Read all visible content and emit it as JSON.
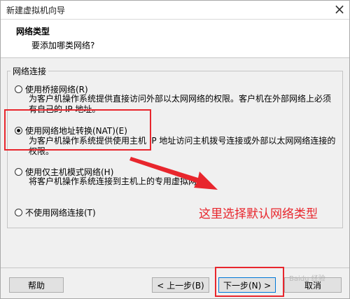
{
  "window": {
    "title": "新建虚拟机向导",
    "close_symbol": "×"
  },
  "header": {
    "title": "网络类型",
    "subtitle": "要添加哪类网络?"
  },
  "group": {
    "label": "网络连接"
  },
  "options": [
    {
      "label": "使用桥接网络(R)",
      "checked": false,
      "desc_line1": "为客户机操作系统提供直接访问外部以太网网络的权限。客户机在外部网络上必须",
      "desc_line2": "有自己的 IP 地址。"
    },
    {
      "label": "使用网络地址转换(NAT)(E)",
      "checked": true,
      "desc_line1": "为客户机操作系统提供使用主机 IP 地址访问主机拨号连接或外部以太网网络连接的",
      "desc_line2": "权限。"
    },
    {
      "label": "使用仅主机模式网络(H)",
      "checked": false,
      "desc_line1": "将客户机操作系统连接到主机上的专用虚拟网络。"
    },
    {
      "label": "不使用网络连接(T)",
      "checked": false
    }
  ],
  "annotation": {
    "text": "这里选择默认网络类型",
    "color": "#e8262d"
  },
  "buttons": {
    "help": "帮助",
    "back": "< 上一步(B)",
    "next": "下一步(N) >",
    "cancel": "取消"
  },
  "watermark": "Baidu 经验"
}
